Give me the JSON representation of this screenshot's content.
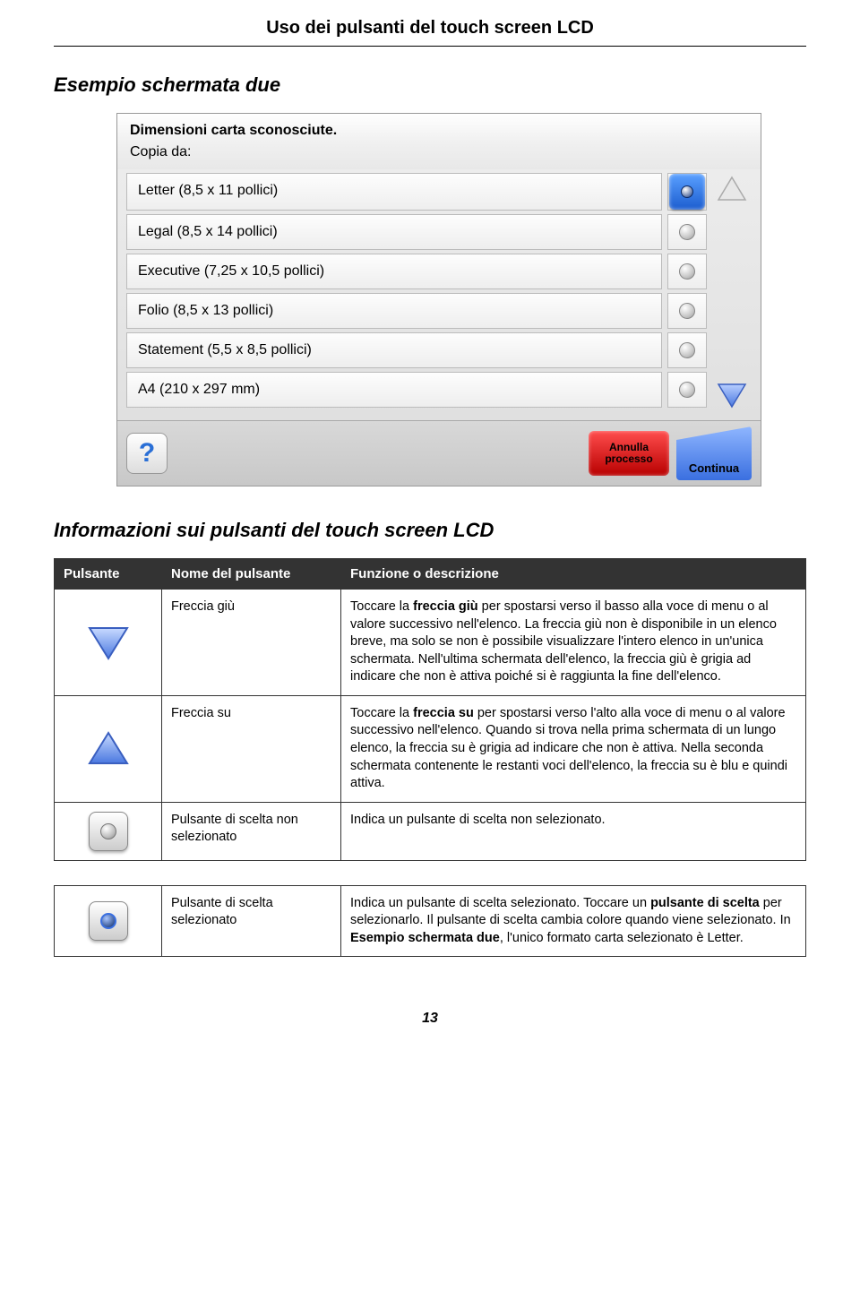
{
  "header": {
    "title": "Uso dei pulsanti del touch screen LCD"
  },
  "example": {
    "heading": "Esempio schermata due"
  },
  "screenshot": {
    "title": "Dimensioni carta sconosciute.",
    "subtitle": "Copia da:",
    "options": [
      {
        "label": "Letter (8,5 x 11 pollici)",
        "selected": true
      },
      {
        "label": "Legal (8,5 x 14 pollici)",
        "selected": false
      },
      {
        "label": "Executive (7,25 x 10,5 pollici)",
        "selected": false
      },
      {
        "label": "Folio (8,5 x 13 pollici)",
        "selected": false
      },
      {
        "label": "Statement (5,5 x 8,5 pollici)",
        "selected": false
      },
      {
        "label": "A4 (210 x 297 mm)",
        "selected": false
      }
    ],
    "help": "?",
    "cancel": "Annulla processo",
    "continue": "Continua"
  },
  "info": {
    "heading": "Informazioni sui pulsanti del touch screen LCD",
    "columns": {
      "button": "Pulsante",
      "name": "Nome del pulsante",
      "desc": "Funzione o descrizione"
    },
    "rows": [
      {
        "name": "Freccia giù",
        "desc_html": "Toccare la <b>freccia giù</b> per spostarsi verso il basso alla voce di menu o al valore successivo nell'elenco. La freccia giù non è disponibile in un elenco breve, ma solo se non è possibile visualizzare l'intero elenco in un'unica schermata. Nell'ultima schermata dell'elenco, la freccia giù è grigia ad indicare che non è attiva poiché si è raggiunta la fine dell'elenco."
      },
      {
        "name": "Freccia su",
        "desc_html": "Toccare la <b>freccia su</b> per spostarsi verso l'alto alla voce di menu o al valore successivo nell'elenco. Quando si trova nella prima schermata di un lungo elenco, la freccia su è grigia ad indicare che non è attiva. Nella seconda schermata contenente le restanti voci dell'elenco, la freccia su è blu e quindi attiva."
      },
      {
        "name": "Pulsante di scelta non selezionato",
        "desc_html": "Indica un pulsante di scelta non selezionato."
      },
      {
        "name": "Pulsante di scelta selezionato",
        "desc_html": "Indica un pulsante di scelta selezionato. Toccare un <b>pulsante di scelta</b> per selezionarlo. Il pulsante di scelta cambia colore quando viene selezionato. In <b>Esempio schermata due</b>, l'unico formato carta selezionato è Letter."
      }
    ]
  },
  "page_number": "13"
}
